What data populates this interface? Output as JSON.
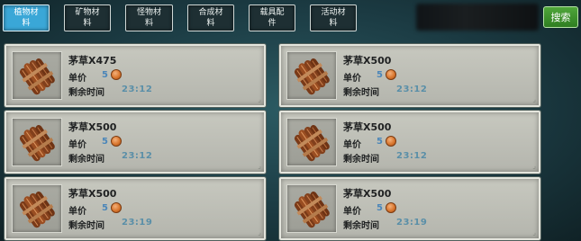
{
  "tabs": [
    {
      "label": "植物材料",
      "active": true
    },
    {
      "label": "矿物材料",
      "active": false
    },
    {
      "label": "怪物材料",
      "active": false
    },
    {
      "label": "合成材料",
      "active": false
    },
    {
      "label": "载具配件",
      "active": false
    },
    {
      "label": "活动材料",
      "active": false
    }
  ],
  "search_button": "搜索",
  "items": [
    {
      "name": "茅草X475",
      "price_label": "单价",
      "price": "5",
      "time_label": "剩余时间",
      "time": "23:12"
    },
    {
      "name": "茅草X500",
      "price_label": "单价",
      "price": "5",
      "time_label": "剩余时间",
      "time": "23:12"
    },
    {
      "name": "茅草X500",
      "price_label": "单价",
      "price": "5",
      "time_label": "剩余时间",
      "time": "23:12"
    },
    {
      "name": "茅草X500",
      "price_label": "单价",
      "price": "5",
      "time_label": "剩余时间",
      "time": "23:12"
    },
    {
      "name": "茅草X500",
      "price_label": "单价",
      "price": "5",
      "time_label": "剩余时间",
      "time": "23:19"
    },
    {
      "name": "茅草X500",
      "price_label": "单价",
      "price": "5",
      "time_label": "剩余时间",
      "time": "23:19"
    }
  ],
  "icons": {
    "item": "thatch-bundle-icon",
    "currency": "copper-coin-icon"
  }
}
